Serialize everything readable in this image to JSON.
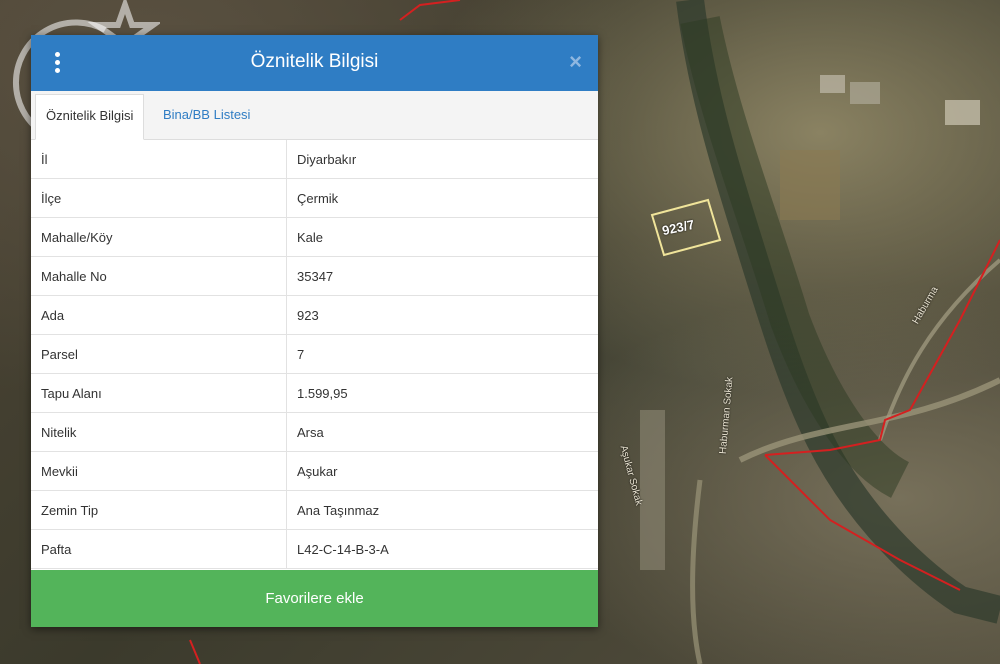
{
  "panel": {
    "title": "Öznitelik Bilgisi",
    "close_label": "×",
    "tabs": [
      {
        "label": "Öznitelik Bilgisi",
        "active": true
      },
      {
        "label": "Bina/BB Listesi",
        "active": false
      }
    ],
    "rows": [
      {
        "key": "İl",
        "value": "Diyarbakır"
      },
      {
        "key": "İlçe",
        "value": "Çermik"
      },
      {
        "key": "Mahalle/Köy",
        "value": "Kale"
      },
      {
        "key": "Mahalle No",
        "value": "35347"
      },
      {
        "key": "Ada",
        "value": "923"
      },
      {
        "key": "Parsel",
        "value": "7"
      },
      {
        "key": "Tapu Alanı",
        "value": "1.599,95"
      },
      {
        "key": "Nitelik",
        "value": "Arsa"
      },
      {
        "key": "Mevkii",
        "value": "Aşukar"
      },
      {
        "key": "Zemin Tip",
        "value": "Ana Taşınmaz"
      },
      {
        "key": "Pafta",
        "value": "L42-C-14-B-3-A"
      }
    ],
    "favorite_button": "Favorilere ekle"
  },
  "map": {
    "parcel_label": "923/7",
    "streets": [
      "Haburma",
      "Aşukar Sokak",
      "Haburman Sokak"
    ]
  },
  "colors": {
    "header": "#2f7dc4",
    "favorite": "#53b45a",
    "boundary": "#d42020",
    "parcel": "#f0e49a"
  },
  "icons": [
    "menu-kebab-icon",
    "close-icon",
    "watermark-logo"
  ]
}
